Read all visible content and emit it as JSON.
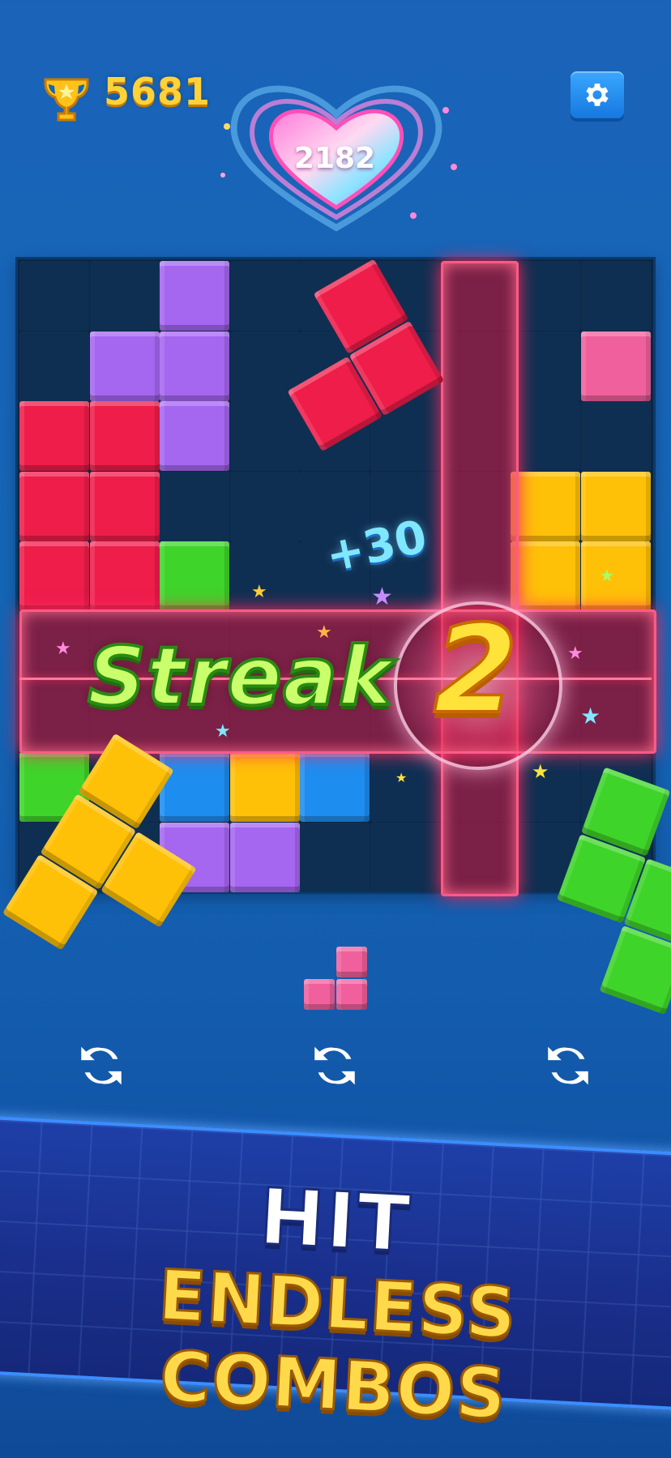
{
  "hud": {
    "high_score": "5681",
    "current_score": "2182"
  },
  "board": {
    "rows": [
      [
        "",
        "",
        "purple",
        "",
        "",
        "",
        "",
        "",
        ""
      ],
      [
        "",
        "purple",
        "purple",
        "",
        "",
        "",
        "",
        "",
        "pink"
      ],
      [
        "red",
        "red",
        "purple",
        "",
        "",
        "",
        "",
        "",
        ""
      ],
      [
        "red",
        "red",
        "",
        "",
        "",
        "",
        "",
        "yellow",
        "yellow"
      ],
      [
        "red",
        "red",
        "green",
        "",
        "",
        "",
        "",
        "yellow",
        "yellow"
      ],
      [
        "",
        "",
        "",
        "",
        "",
        "",
        "",
        "",
        ""
      ],
      [
        "",
        "",
        "",
        "",
        "",
        "",
        "",
        "",
        ""
      ],
      [
        "green",
        "",
        "blue",
        "yellow",
        "blue",
        "",
        "",
        "",
        ""
      ],
      [
        "",
        "",
        "purple",
        "purple",
        "",
        "",
        "",
        "",
        ""
      ]
    ]
  },
  "effects": {
    "score_popup": "+30",
    "streak_label": "Streak",
    "streak_count": "2"
  },
  "colors": {
    "purple": "#a566f0",
    "red": "#ee1d4a",
    "pink": "#f0609c",
    "yellow": "#ffc107",
    "green": "#3fd42a",
    "blue": "#1e8df0"
  },
  "tray": {
    "refresh_icon": "refresh-icon"
  },
  "banner": {
    "line1": "HIT",
    "line2": "ENDLESS COMBOS"
  }
}
